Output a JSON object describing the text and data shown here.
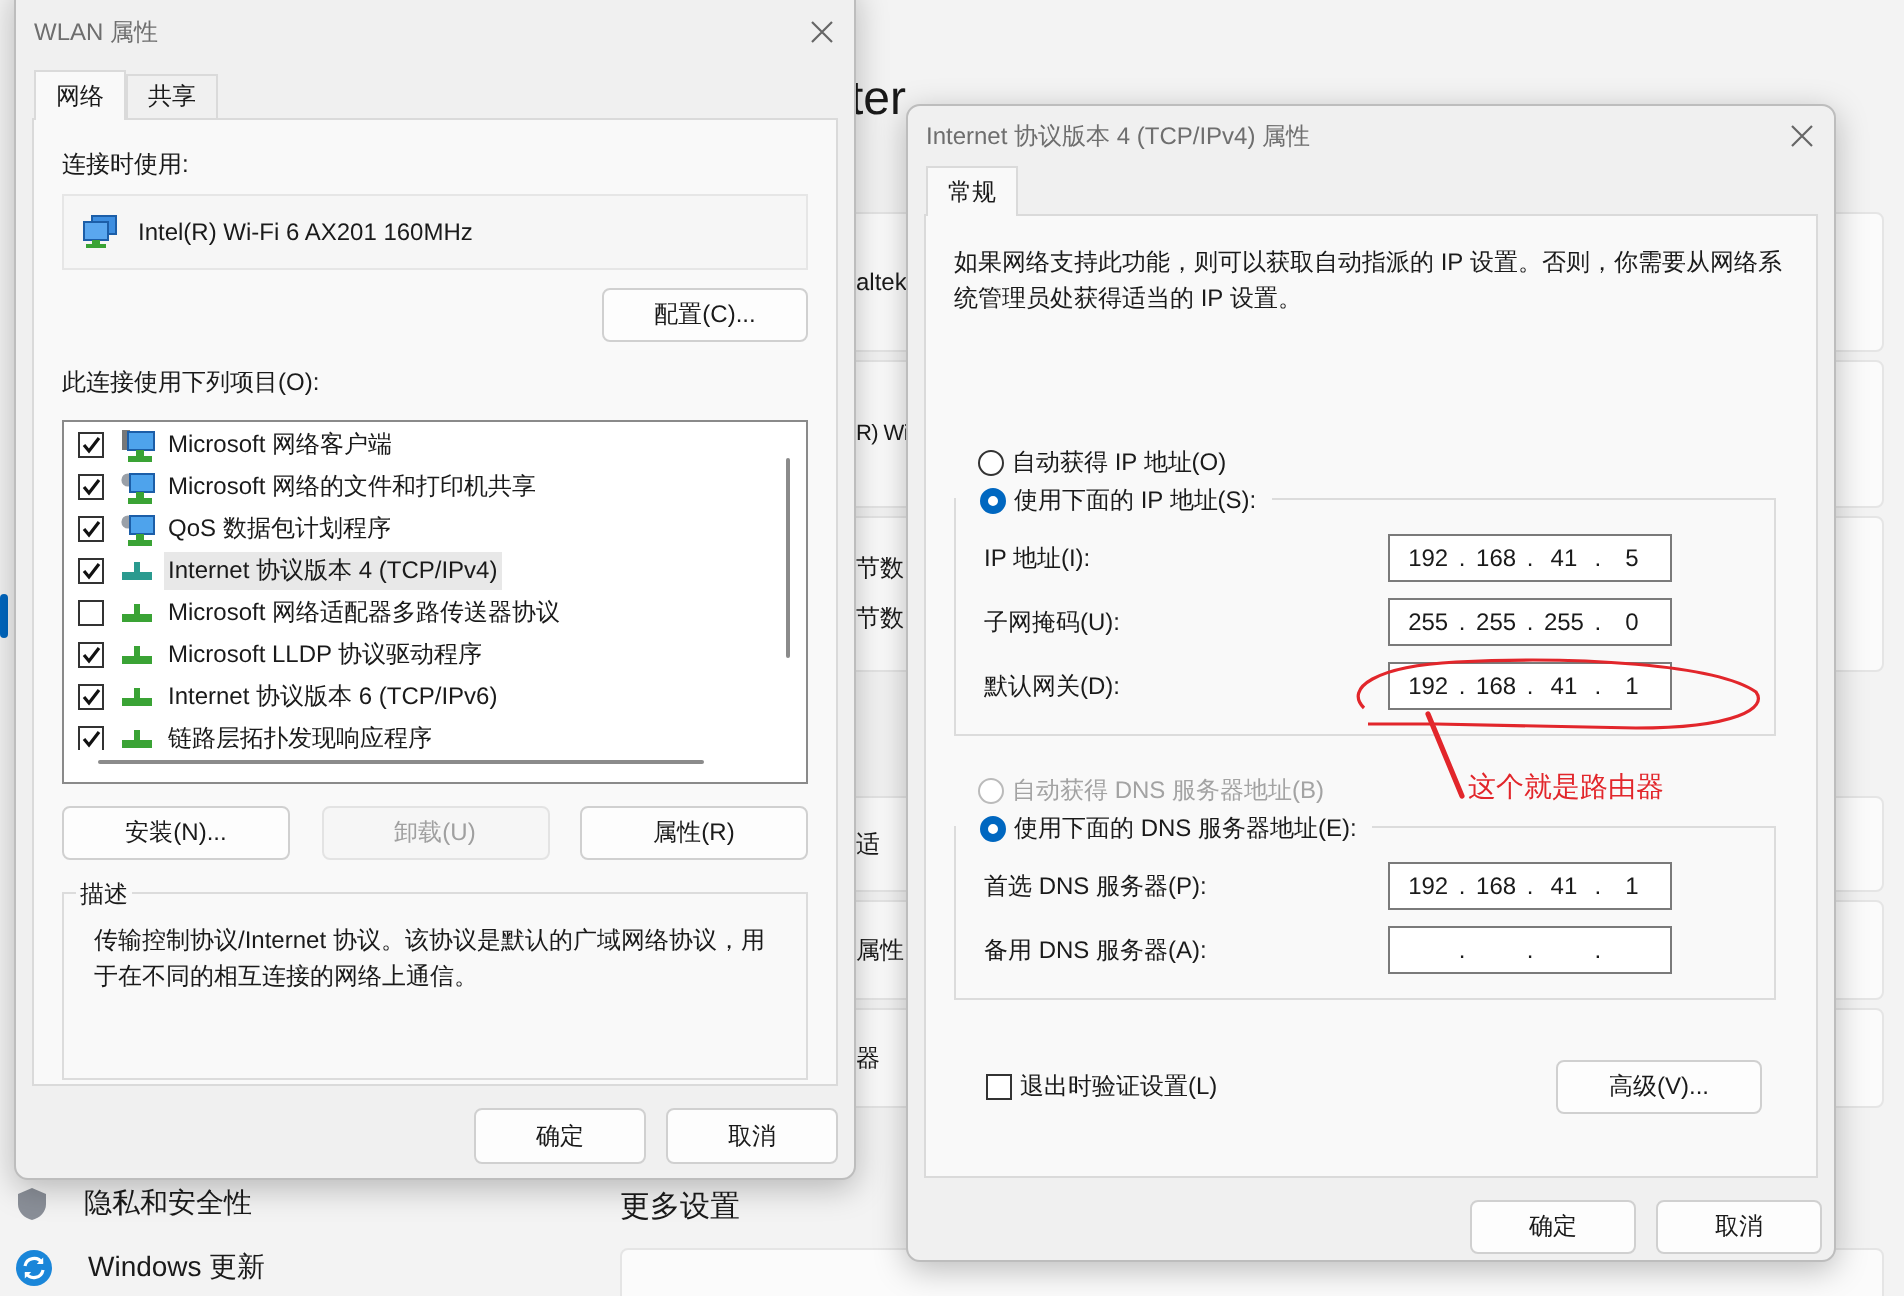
{
  "background": {
    "heading": "ter",
    "cards": [
      {
        "lines": [
          "altek"
        ]
      },
      {
        "lines": [
          "R) Wi"
        ]
      },
      {
        "lines": [
          "节数",
          "节数"
        ]
      },
      {
        "lines": [
          "适"
        ]
      },
      {
        "lines": [
          "属性"
        ]
      },
      {
        "lines": [
          "器"
        ]
      }
    ],
    "sidebar_items": [
      {
        "label": "隐私和安全性"
      },
      {
        "label": "Windows 更新"
      }
    ],
    "section_title": "更多设置"
  },
  "wlan_dialog": {
    "title": "WLAN 属性",
    "tabs": [
      {
        "label": "网络",
        "selected": true
      },
      {
        "label": "共享",
        "selected": false
      }
    ],
    "connect_label": "连接时使用:",
    "adapter": "Intel(R) Wi-Fi 6 AX201 160MHz",
    "configure_button": "配置(C)...",
    "items_label": "此连接使用下列项目(O):",
    "items": [
      {
        "label": "Microsoft 网络客户端",
        "kind": "client",
        "checked": true,
        "selected": false
      },
      {
        "label": "Microsoft 网络的文件和打印机共享",
        "kind": "service",
        "checked": true,
        "selected": false
      },
      {
        "label": "QoS 数据包计划程序",
        "kind": "service",
        "checked": true,
        "selected": false
      },
      {
        "label": "Internet 协议版本 4 (TCP/IPv4)",
        "kind": "protocol",
        "checked": true,
        "selected": true
      },
      {
        "label": "Microsoft 网络适配器多路传送器协议",
        "kind": "protocol",
        "checked": false,
        "selected": false
      },
      {
        "label": "Microsoft LLDP 协议驱动程序",
        "kind": "protocol",
        "checked": true,
        "selected": false
      },
      {
        "label": "Internet 协议版本 6 (TCP/IPv6)",
        "kind": "protocol",
        "checked": true,
        "selected": false
      },
      {
        "label": "链路层拓扑发现响应程序",
        "kind": "protocol",
        "checked": true,
        "selected": false
      }
    ],
    "buttons": [
      {
        "label": "安装(N)...",
        "disabled": false
      },
      {
        "label": "卸载(U)",
        "disabled": true
      },
      {
        "label": "属性(R)",
        "disabled": false
      }
    ],
    "description_title": "描述",
    "description": "传输控制协议/Internet 协议。该协议是默认的广域网络协议，用于在不同的相互连接的网络上通信。",
    "footer_buttons": [
      "确定",
      "取消"
    ]
  },
  "ipv4_dialog": {
    "title": "Internet 协议版本 4 (TCP/IPv4) 属性",
    "tabs": [
      {
        "label": "常规",
        "selected": true
      }
    ],
    "intro": "如果网络支持此功能，则可以获取自动指派的 IP 设置。否则，你需要从网络系统管理员处获得适当的 IP 设置。",
    "sections": [
      {
        "auto": {
          "label": "自动获得 IP 地址(O)",
          "selected": false,
          "disabled": false
        },
        "manual": {
          "label": "使用下面的 IP 地址(S):",
          "selected": true,
          "disabled": false
        },
        "fields": [
          {
            "label": "IP 地址(I):",
            "octets": [
              "192",
              "168",
              "41",
              "5"
            ],
            "separator": "."
          },
          {
            "label": "子网掩码(U):",
            "octets": [
              "255",
              "255",
              "255",
              "0"
            ],
            "separator": "."
          },
          {
            "label": "默认网关(D):",
            "octets": [
              "192",
              "168",
              "41",
              "1"
            ],
            "separator": "."
          }
        ]
      },
      {
        "auto": {
          "label": "自动获得 DNS 服务器地址(B)",
          "selected": false,
          "disabled": true
        },
        "manual": {
          "label": "使用下面的 DNS 服务器地址(E):",
          "selected": true,
          "disabled": false
        },
        "fields": [
          {
            "label": "首选 DNS 服务器(P):",
            "octets": [
              "192",
              "168",
              "41",
              "1"
            ],
            "separator": "."
          },
          {
            "label": "备用 DNS 服务器(A):",
            "separator": "."
          }
        ]
      }
    ],
    "validate": {
      "label": "退出时验证设置(L)",
      "checked": false
    },
    "advanced_button": "高级(V)...",
    "footer_buttons": [
      "确定",
      "取消"
    ]
  },
  "annotation": {
    "text": "这个就是路由器"
  }
}
